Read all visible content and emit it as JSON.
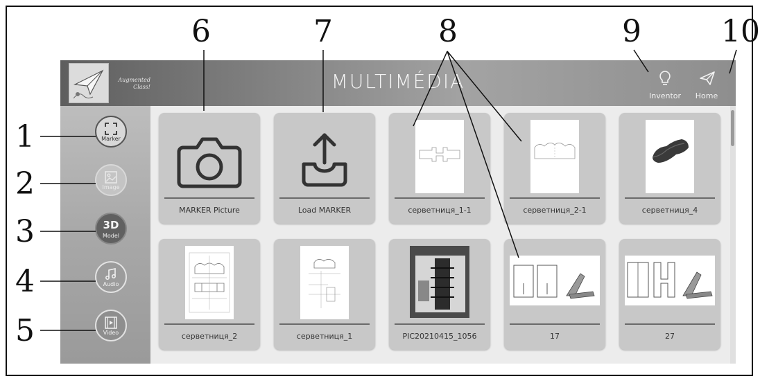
{
  "callouts": {
    "n1": "1",
    "n2": "2",
    "n3": "3",
    "n4": "4",
    "n5": "5",
    "n6": "6",
    "n7": "7",
    "n8": "8",
    "n9": "9",
    "n10": "10"
  },
  "header": {
    "logo_text_line1": "Augmented",
    "logo_text_line2": "Class!",
    "title": "MULTIMÉDIA",
    "inventor_label": "Inventor",
    "home_label": "Home"
  },
  "sidebar": {
    "items": [
      {
        "label": "Marker",
        "icon": "marker-frame-icon",
        "state": "selected"
      },
      {
        "label": "Image",
        "icon": "image-icon",
        "state": "disabled"
      },
      {
        "label": "Model",
        "badge": "3D",
        "icon": "3d-model-icon",
        "state": "active"
      },
      {
        "label": "Audio",
        "icon": "music-note-icon",
        "state": "normal"
      },
      {
        "label": "Video",
        "icon": "film-icon",
        "state": "normal"
      }
    ]
  },
  "grid": {
    "row1": [
      {
        "caption": "MARKER Picture",
        "icon": "camera-icon"
      },
      {
        "caption": "Load MARKER",
        "icon": "upload-icon"
      },
      {
        "caption": "серветниця_1-1",
        "icon": "sketch-thumbnail"
      },
      {
        "caption": "серветниця_2-1",
        "icon": "sketch-thumbnail"
      },
      {
        "caption": "серветниця_4",
        "icon": "model-thumbnail"
      }
    ],
    "row2": [
      {
        "caption": "серветниця_2",
        "icon": "drawing-thumbnail"
      },
      {
        "caption": "серветниця_1",
        "icon": "drawing-thumbnail"
      },
      {
        "caption": "PIC20210415_1056",
        "icon": "photo-thumbnail"
      },
      {
        "caption": "17",
        "icon": "parts-thumbnail"
      },
      {
        "caption": "27",
        "icon": "parts-thumbnail"
      }
    ]
  },
  "colors": {
    "header_dark": "#5e5e5e",
    "header_light": "#a3a3a3",
    "card": "#c8c8c8",
    "sidebar": "#aaaaaa"
  }
}
